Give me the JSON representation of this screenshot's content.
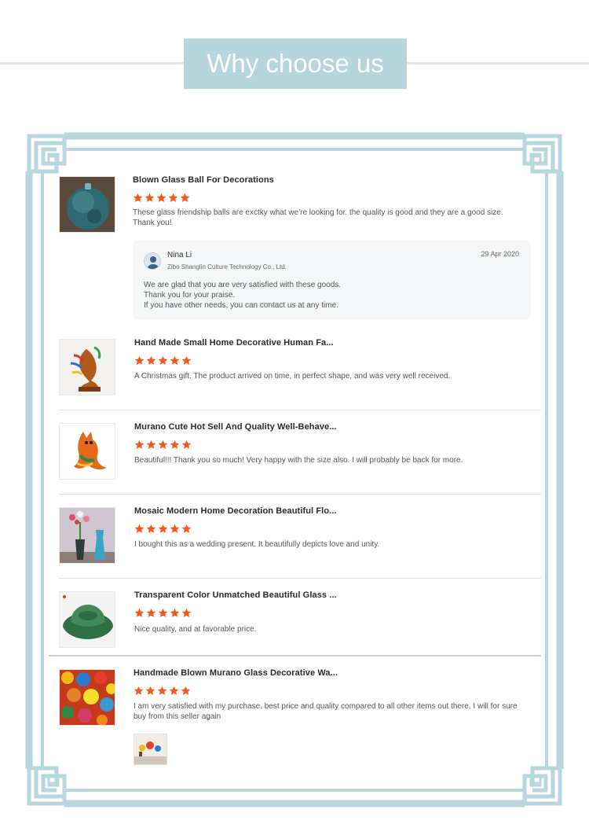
{
  "header": {
    "title": "Why choose us"
  },
  "colors": {
    "title_bg": "#b5d4dc",
    "frame": "#b8d6de",
    "star": "#f25a1d",
    "divider": "#dedede"
  },
  "reviews": [
    {
      "product": "Blown Glass Ball For Decorations",
      "rating": 5,
      "text": "These glass friendship balls are exctky what we're looking for. the quality is good and they are a good size. Thank you!",
      "thumb_icon": "glass-ball-image"
    },
    {
      "product": "Hand Made Small Home Decorative Human Fa...",
      "rating": 5,
      "text": "A Christmas gift. The product arrived on time, in perfect shape, and was very well received.",
      "thumb_icon": "human-face-sculpture-image"
    },
    {
      "product": "Murano Cute Hot Sell And Quality Well-Behave...",
      "rating": 5,
      "text": "Beautiful!!! Thank you so much! Very happy with the size also. I will probably be back for more.",
      "thumb_icon": "glass-cat-figurine-image"
    },
    {
      "product": "Mosaic Modern Home Decoration Beautiful Flo...",
      "rating": 5,
      "text": "I bought this as a wedding present. It beautifully depicts love and unity.",
      "thumb_icon": "flower-vases-image"
    },
    {
      "product": "Transparent Color Unmatched Beautiful Glass ...",
      "rating": 5,
      "text": "Nice quality, and at favorable price.",
      "thumb_icon": "green-glass-bowl-image"
    },
    {
      "product": "Handmade Blown Murano Glass Decorative Wa...",
      "rating": 5,
      "text": "I am very satisfied with my purchase. best price and quality compared to all other items out there. I will for sure buy from this seller again",
      "thumb_icon": "glass-wall-art-image"
    }
  ],
  "reply": {
    "name": "Nina Li",
    "company": "Zibo Shanglin Culture Technology Co., Ltd.",
    "date": "29 Apr 2020",
    "lines": [
      "We are glad that you are very satisfied with these goods.",
      "Thank you for your praise.",
      "If you have other needs, you can contact us at any time."
    ]
  }
}
